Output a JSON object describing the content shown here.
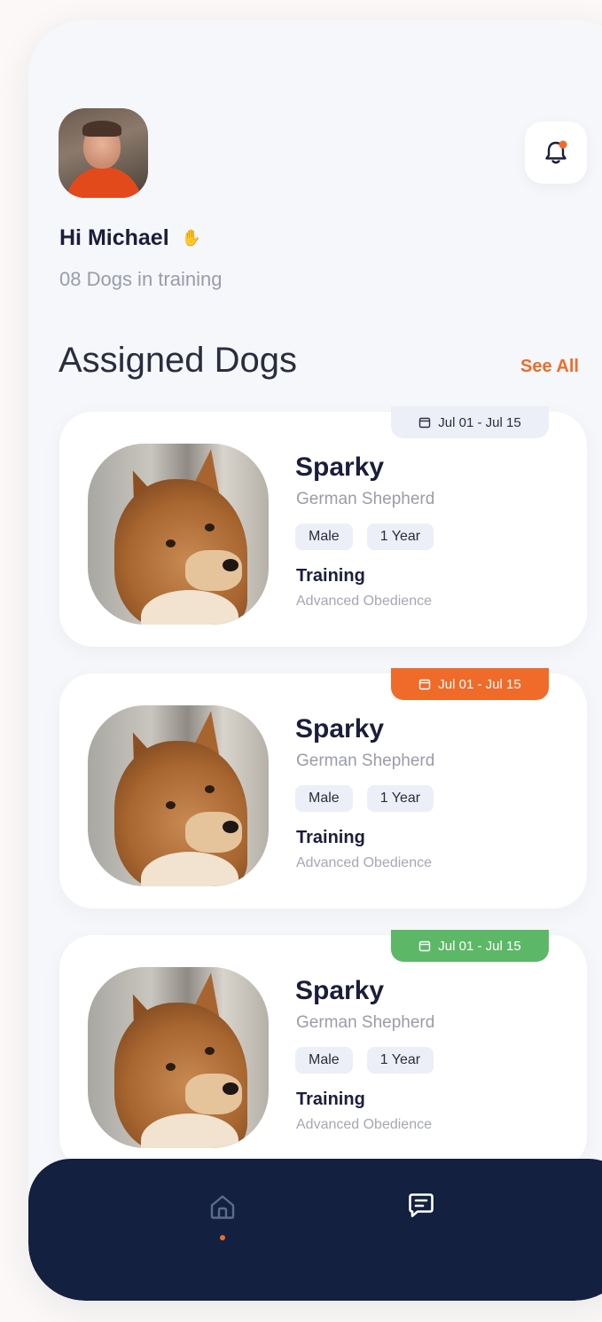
{
  "header": {
    "greeting": "Hi Michael",
    "wave_icon": "waving-hand-icon",
    "subtitle": "08 Dogs in training",
    "notification_icon": "bell-icon",
    "accent": "#f06b2a"
  },
  "section": {
    "title": "Assigned Dogs",
    "see_all": "See All"
  },
  "cards": [
    {
      "date_range": "Jul 01 - Jul 15",
      "status_color": "#eceff7",
      "name": "Sparky",
      "breed": "German Shepherd",
      "gender": "Male",
      "age": "1 Year",
      "training_label": "Training",
      "training_value": "Advanced Obedience"
    },
    {
      "date_range": "Jul 01 - Jul 15",
      "status_color": "#f06b2a",
      "name": "Sparky",
      "breed": "German Shepherd",
      "gender": "Male",
      "age": "1 Year",
      "training_label": "Training",
      "training_value": "Advanced Obedience"
    },
    {
      "date_range": "Jul 01 - Jul 15",
      "status_color": "#5cb866",
      "name": "Sparky",
      "breed": "German Shepherd",
      "gender": "Male",
      "age": "1 Year",
      "training_label": "Training",
      "training_value": "Advanced Obedience"
    }
  ],
  "nav": {
    "items": [
      {
        "icon": "home-icon",
        "active": true
      },
      {
        "icon": "chat-icon",
        "active": false
      }
    ],
    "background": "#13203f"
  }
}
